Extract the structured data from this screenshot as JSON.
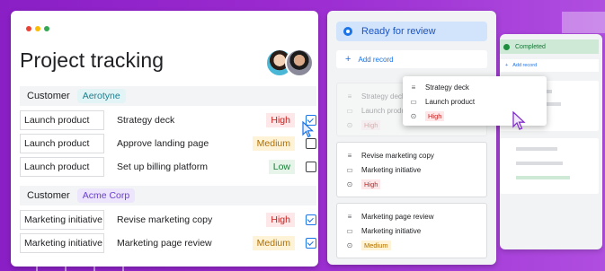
{
  "left_panel": {
    "title": "Project tracking",
    "window_dots": [
      "#ea4335",
      "#fbbc04",
      "#34a853"
    ],
    "groups": [
      {
        "label": "Customer",
        "tag": "Aerotyne",
        "rows": [
          {
            "project": "Launch product",
            "task": "Strategy deck",
            "priority": "High",
            "checked": true
          },
          {
            "project": "Launch product",
            "task": "Approve landing page",
            "priority": "Medium",
            "checked": false
          },
          {
            "project": "Launch product",
            "task": "Set up billing platform",
            "priority": "Low",
            "checked": false
          }
        ]
      },
      {
        "label": "Customer",
        "tag": "Acme Corp",
        "rows": [
          {
            "project": "Marketing initiative",
            "task": "Revise marketing copy",
            "priority": "High",
            "checked": true
          },
          {
            "project": "Marketing initiative",
            "task": "Marketing page review",
            "priority": "Medium",
            "checked": true
          }
        ]
      }
    ]
  },
  "board": {
    "column_title": "Ready for review",
    "add_record": "Add record",
    "ghost_card": {
      "task": "Strategy deck",
      "project": "Launch product",
      "priority": "High"
    },
    "popup_card": {
      "task": "Strategy deck",
      "project": "Launch product",
      "priority": "High"
    },
    "cards": [
      {
        "task": "Revise marketing copy",
        "project": "Marketing initiative",
        "priority": "High"
      },
      {
        "task": "Marketing page review",
        "project": "Marketing initiative",
        "priority": "Medium"
      }
    ]
  },
  "completed_column": {
    "title": "Completed",
    "add_record": "Add record"
  },
  "colors": {
    "accent_blue": "#1a73e8",
    "high": "#c5221f",
    "medium": "#b06f00",
    "low": "#188038",
    "background_purple": "#9a2ad0"
  }
}
